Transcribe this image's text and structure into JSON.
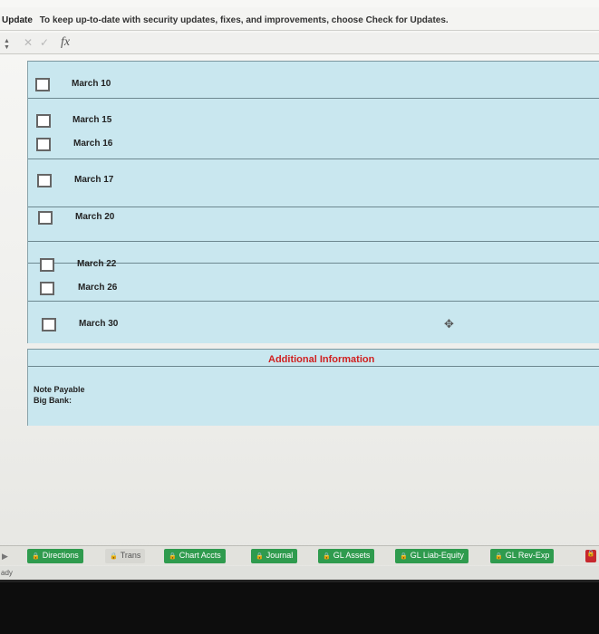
{
  "update_bar": {
    "label": "Update",
    "message": "To keep up-to-date with security updates, fixes, and improvements, choose Check for Updates."
  },
  "formula_bar": {
    "cancel_icon": "✕",
    "enter_icon": "✓",
    "fx_label": "fx"
  },
  "checklist": [
    {
      "label": "March 10"
    },
    {
      "label": "March 15"
    },
    {
      "label": "March 16"
    },
    {
      "label": "March 17"
    },
    {
      "label": "March 20"
    },
    {
      "label": "March 22"
    },
    {
      "label": "March 26"
    },
    {
      "label": "March 30"
    }
  ],
  "info": {
    "title": "Additional Information",
    "note_title": "Note Payable",
    "note_sub": "Big Bank:"
  },
  "tabs": [
    {
      "label": "Directions"
    },
    {
      "label": "Trans"
    },
    {
      "label": "Chart Accts"
    },
    {
      "label": "Journal"
    },
    {
      "label": "GL Assets"
    },
    {
      "label": "GL Liab-Equity"
    },
    {
      "label": "GL Rev-Exp"
    }
  ],
  "status": {
    "text": "ady"
  },
  "colors": {
    "panel": "#c9e7ef",
    "active_tab": "#2f9b4e",
    "accent_red": "#d02020"
  }
}
